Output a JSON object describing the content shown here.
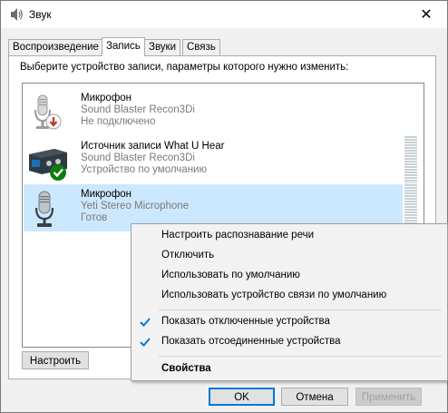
{
  "window": {
    "title": "Звук",
    "icon": "speaker-icon",
    "close_glyph": "✕"
  },
  "tabs": [
    {
      "label": "Воспроизведение",
      "active": false
    },
    {
      "label": "Запись",
      "active": true
    },
    {
      "label": "Звуки",
      "active": false
    },
    {
      "label": "Связь",
      "active": false
    }
  ],
  "instruction": "Выберите устройство записи, параметры которого нужно изменить:",
  "devices": [
    {
      "name": "Микрофон",
      "driver": "Sound Blaster Recon3Di",
      "status": "Не подключено",
      "icon": "microphone-disconnected-icon",
      "selected": false
    },
    {
      "name": "Источник записи What U Hear",
      "driver": "Sound Blaster Recon3Di",
      "status": "Устройство по умолчанию",
      "icon": "line-in-default-icon",
      "selected": false
    },
    {
      "name": "Микрофон",
      "driver": "Yeti Stereo Microphone",
      "status": "Готов",
      "icon": "microphone-icon",
      "selected": true
    }
  ],
  "buttons": {
    "configure": "Настроить",
    "ok": "OK",
    "cancel": "Отмена",
    "apply": "Применить"
  },
  "context_menu": {
    "items": [
      {
        "label": "Настроить распознавание речи",
        "checked": false,
        "bold": false
      },
      {
        "label": "Отключить",
        "checked": false,
        "bold": false
      },
      {
        "label": "Использовать по умолчанию",
        "checked": false,
        "bold": false
      },
      {
        "label": "Использовать устройство связи по умолчанию",
        "checked": false,
        "bold": false
      },
      {
        "label": "Показать отключенные устройства",
        "checked": true,
        "bold": false
      },
      {
        "label": "Показать отсоединенные устройства",
        "checked": true,
        "bold": false
      },
      {
        "label": "Свойства",
        "checked": false,
        "bold": true
      }
    ]
  },
  "colors": {
    "selection": "#cce8ff",
    "accent": "#0078d7",
    "default_badge": "#107c10",
    "disconnected_badge": "#d9534f"
  }
}
